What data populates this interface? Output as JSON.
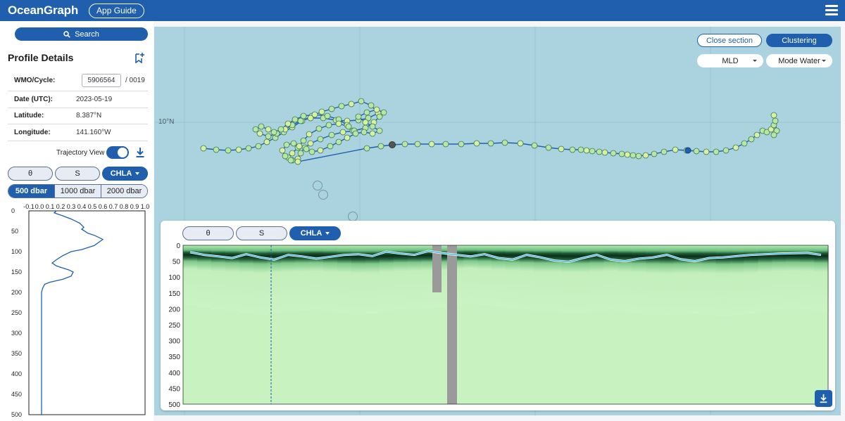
{
  "header": {
    "brand": "OceanGraph",
    "guide_label": "App Guide"
  },
  "sidebar": {
    "search_label": "Search",
    "title": "Profile Details",
    "wmo_label": "WMO/Cycle:",
    "wmo_value": "5906564",
    "cycle": "/  0019",
    "date_label": "Date (UTC):",
    "date_value": "2023-05-19",
    "lat_label": "Latitude:",
    "lat_value": "8.387°N",
    "lon_label": "Longitude:",
    "lon_value": "141.160°W",
    "trajectory_label": "Trajectory View",
    "trajectory_on": true,
    "variables": [
      "θ",
      "S",
      "CHLA"
    ],
    "active_variable": "CHLA",
    "depths": [
      "500 dbar",
      "1000 dbar",
      "2000 dbar"
    ],
    "active_depth": "500 dbar"
  },
  "map": {
    "close_label": "Close section",
    "cluster_label": "Clustering",
    "mld_select": "MLD",
    "mode_select": "Mode Water",
    "lat_gridlabel": "10°N"
  },
  "section": {
    "variables": [
      "θ",
      "S",
      "CHLA"
    ],
    "active_variable": "CHLA"
  },
  "colors": {
    "brand": "#1f5fad",
    "ocean": "#aad3df",
    "track": "#1f5fad",
    "float_point": "#b9e6a5",
    "chla_low": "#c8f2c0",
    "chla_high": "#0c2e1a"
  },
  "chart_data": [
    {
      "type": "line",
      "xlim": [
        -0.1,
        1.0
      ],
      "x_ticks": [
        "-0.1",
        "0.0",
        "0.1",
        "0.2",
        "0.3",
        "0.4",
        "0.5",
        "0.6",
        "0.7",
        "0.8",
        "0.9",
        "1.0"
      ],
      "ylim": [
        0,
        500
      ],
      "y_ticks": [
        "0",
        "50",
        "100",
        "150",
        "200",
        "250",
        "300",
        "350",
        "400",
        "450",
        "500"
      ],
      "y_inverted": true,
      "series": [
        {
          "x": [
            0.16,
            0.14,
            0.22,
            0.3,
            0.38,
            0.42,
            0.4,
            0.46,
            0.52,
            0.6,
            0.52,
            0.4,
            0.3,
            0.22,
            0.16,
            0.12,
            0.16,
            0.22,
            0.28,
            0.32,
            0.3,
            0.22,
            0.1,
            0.05,
            0.03,
            0.02,
            0.02,
            0.02,
            0.02,
            0.02,
            0.02
          ],
          "y": [
            0,
            5,
            12,
            20,
            30,
            40,
            45,
            55,
            60,
            70,
            85,
            95,
            100,
            110,
            120,
            128,
            135,
            140,
            145,
            150,
            160,
            168,
            175,
            180,
            190,
            200,
            250,
            300,
            350,
            400,
            500
          ]
        }
      ]
    },
    {
      "type": "heatmap",
      "ylim": [
        0,
        500
      ],
      "y_ticks": [
        "0",
        "50",
        "100",
        "150",
        "200",
        "250",
        "300",
        "350",
        "400",
        "450",
        "500"
      ],
      "y_inverted": true,
      "dcm_depth_profile": [
        72,
        75,
        78,
        80,
        82,
        84,
        82,
        80,
        79,
        78,
        80,
        82,
        84,
        83,
        80,
        78,
        77,
        76,
        75,
        72,
        70,
        72,
        74,
        76,
        78,
        80,
        80,
        82,
        82,
        80,
        78,
        80,
        82,
        84,
        85,
        84,
        83,
        84,
        86,
        85,
        83,
        80,
        78,
        77,
        78,
        80
      ],
      "mld_profile": [
        22,
        30,
        35,
        40,
        28,
        38,
        45,
        30,
        35,
        42,
        36,
        30,
        28,
        34,
        20,
        26,
        30,
        18,
        25,
        30,
        35,
        28,
        40,
        45,
        30,
        38,
        48,
        52,
        40,
        30,
        45,
        50,
        42,
        38,
        30,
        44,
        50,
        40,
        38,
        34,
        30,
        28,
        26,
        25,
        24,
        30
      ]
    }
  ]
}
